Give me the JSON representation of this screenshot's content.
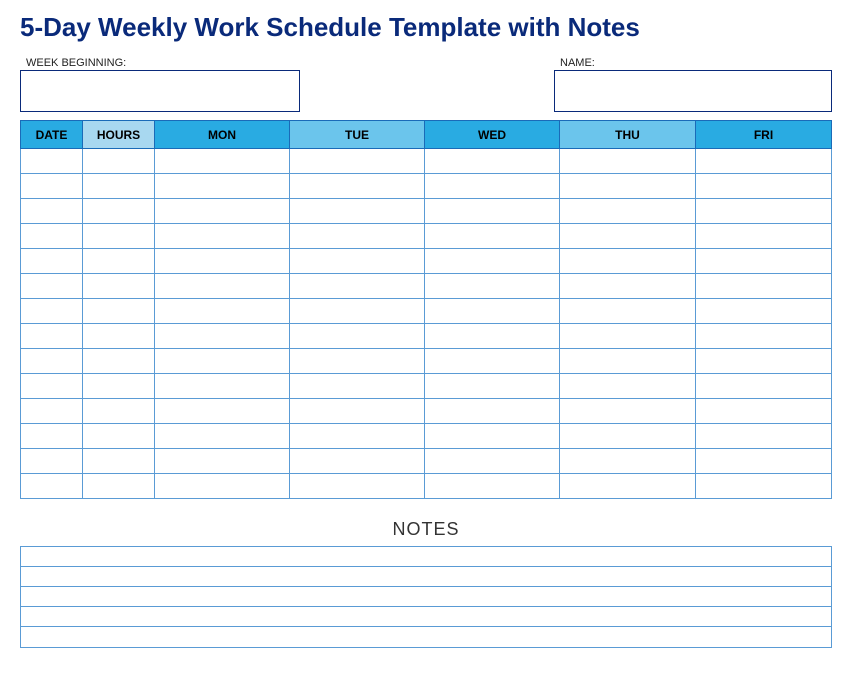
{
  "title": "5-Day Weekly Work Schedule Template with Notes",
  "fields": {
    "week_label": "WEEK BEGINNING:",
    "week_value": "",
    "name_label": "NAME:",
    "name_value": ""
  },
  "table": {
    "headers": {
      "date": "DATE",
      "hours": "HOURS",
      "mon": "MON",
      "tue": "TUE",
      "wed": "WED",
      "thu": "THU",
      "fri": "FRI"
    },
    "row_count": 14
  },
  "notes": {
    "heading": "NOTES",
    "line_count": 5
  }
}
